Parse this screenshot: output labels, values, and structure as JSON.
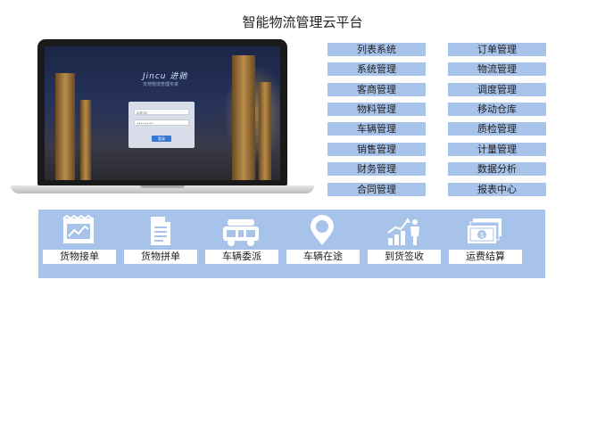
{
  "page": {
    "title": "智能物流管理云平台"
  },
  "laptop": {
    "brand": "Jincu 进驰",
    "brand_sub": "天地物流管理专家",
    "username_hint": "admin",
    "password_hint": "••••••••",
    "login_label": "登录"
  },
  "menu": {
    "left": [
      "列表系统",
      "系统管理",
      "客商管理",
      "物料管理",
      "车辆管理",
      "销售管理",
      "财务管理",
      "合同管理"
    ],
    "right": [
      "订单管理",
      "物流管理",
      "调度管理",
      "移动仓库",
      "质检管理",
      "计量管理",
      "数据分析",
      "报表中心"
    ]
  },
  "process": {
    "steps": [
      {
        "label": "货物接单",
        "icon": "receipt-icon"
      },
      {
        "label": "货物拼单",
        "icon": "document-icon"
      },
      {
        "label": "车辆委派",
        "icon": "truck-icon"
      },
      {
        "label": "车辆在途",
        "icon": "location-pin-icon"
      },
      {
        "label": "到货签收",
        "icon": "delivery-chart-icon"
      },
      {
        "label": "运费结算",
        "icon": "cash-icon"
      }
    ]
  },
  "colors": {
    "accent": "#a8c3ea",
    "icon": "#ffffff"
  }
}
